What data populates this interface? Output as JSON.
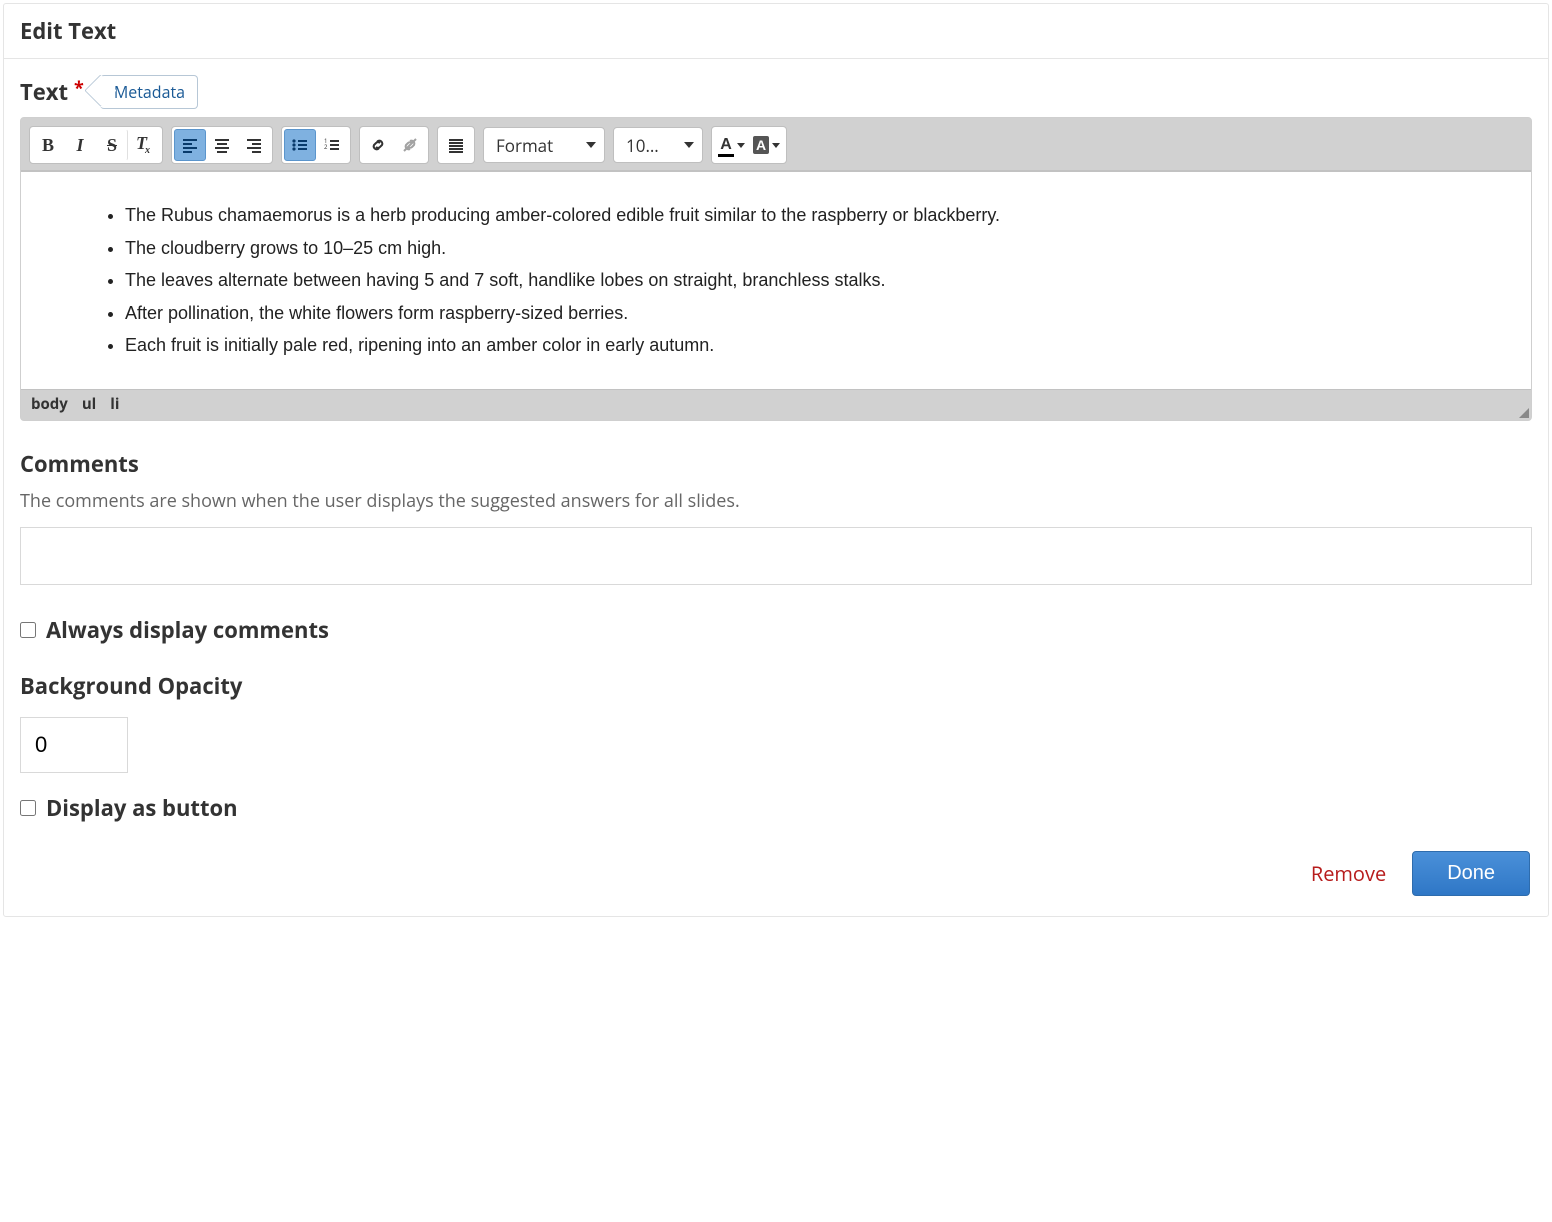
{
  "header": {
    "title": "Edit Text"
  },
  "text_field": {
    "label": "Text",
    "metadata_label": "Metadata"
  },
  "toolbar": {
    "format_label": "Format",
    "size_label": "10…"
  },
  "content_items": [
    "The Rubus chamaemorus is a herb producing amber-colored edible fruit similar to the raspberry or blackberry.",
    "The cloudberry grows to 10–25 cm high.",
    "The leaves alternate between having 5 and 7 soft, handlike lobes on straight, branchless stalks.",
    "After pollination, the white flowers form raspberry-sized berries.",
    "Each fruit is initially pale red, ripening into an amber color in early autumn."
  ],
  "path": {
    "p0": "body",
    "p1": "ul",
    "p2": "li"
  },
  "comments": {
    "title": "Comments",
    "help": "The comments are shown when the user displays the suggested answers for all slides.",
    "value": "",
    "always_label": "Always display comments"
  },
  "opacity": {
    "title": "Background Opacity",
    "value": "0"
  },
  "display_button": {
    "label": "Display as button"
  },
  "footer": {
    "remove": "Remove",
    "done": "Done"
  }
}
